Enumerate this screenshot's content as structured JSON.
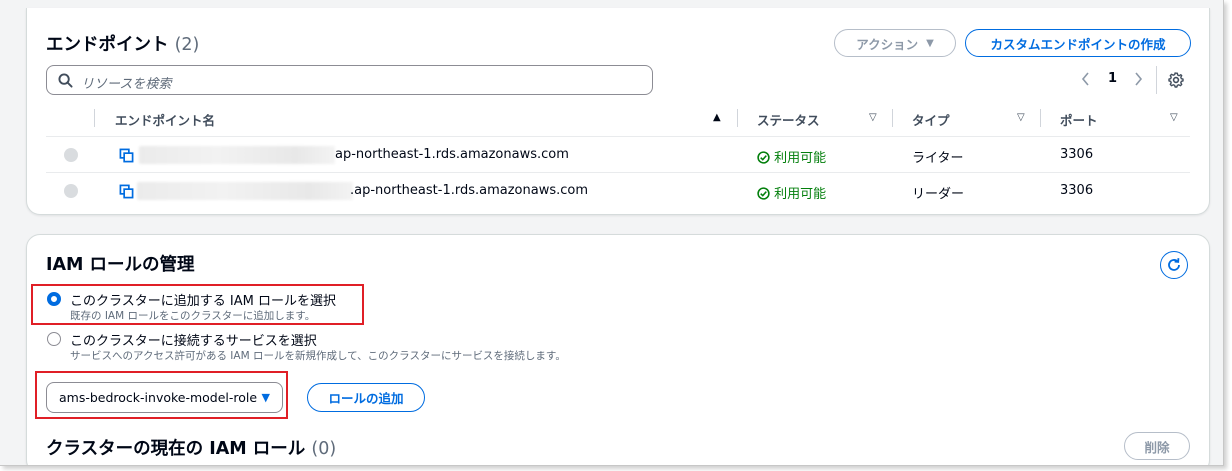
{
  "endpoints": {
    "title": "エンドポイント",
    "count": "(2)",
    "actions_label": "アクション",
    "create_label": "カスタムエンドポイントの作成",
    "search_placeholder": "リソースを検索",
    "page": "1",
    "columns": [
      "エンドポイント名",
      "ステータス",
      "タイプ",
      "ポート"
    ],
    "rows": [
      {
        "name_suffix": "ap-northeast-1.rds.amazonaws.com",
        "status": "利用可能",
        "type": "ライター",
        "port": "3306"
      },
      {
        "name_suffix": ".ap-northeast-1.rds.amazonaws.com",
        "status": "利用可能",
        "type": "リーダー",
        "port": "3306"
      }
    ]
  },
  "iam": {
    "title": "IAM ロールの管理",
    "option1_label": "このクラスターに追加する IAM ロールを選択",
    "option1_desc": "既存の IAM ロールをこのクラスターに追加します。",
    "option2_label": "このクラスターに接続するサービスを選択",
    "option2_desc": "サービスへのアクセス許可がある IAM ロールを新規作成して、このクラスターにサービスを接続します。",
    "selected_role": "ams-bedrock-invoke-model-role",
    "add_role_label": "ロールの追加",
    "current_title": "クラスターの現在の IAM ロール",
    "current_count": "(0)",
    "delete_label": "削除"
  },
  "colors": {
    "accent": "#006ce0",
    "success": "#037f0c",
    "highlight": "#e01f26"
  }
}
